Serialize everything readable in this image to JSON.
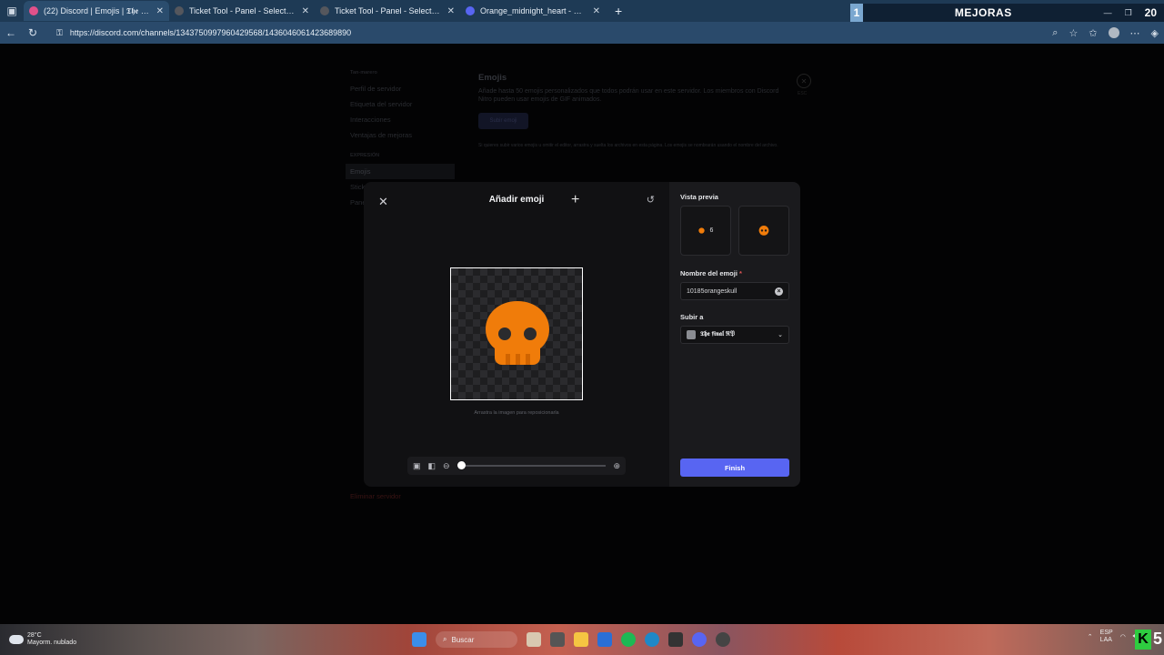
{
  "browser": {
    "tabs": [
      {
        "title": "(22) Discord | Emojis | 𝕿𝖍𝖊 𝖋𝖎𝖓𝖆𝖑 ℜ𝔓",
        "color": "#e0518a",
        "active": true
      },
      {
        "title": "Ticket Tool - Panel - Select Style",
        "color": "#2d2f35",
        "active": false
      },
      {
        "title": "Ticket Tool - Panel - Select Style",
        "color": "#2d2f35",
        "active": false
      },
      {
        "title": "Orange_midnight_heart - Discord",
        "color": "#5865f2",
        "active": false
      }
    ],
    "new_tab": "+",
    "url": "https://discord.com/channels/1343750997960429568/1436046061423689890",
    "overlay": {
      "number": "1",
      "label": "MEJORAS",
      "big_number": "20"
    }
  },
  "settings_sidebar": {
    "header_1": "Tan-marero",
    "items_1": [
      "Perfil de servidor",
      "Etiqueta del servidor",
      "Interacciones",
      "Ventajas de mejoras"
    ],
    "header_2": "EXPRESIÓN",
    "items_2": [
      "Emojis",
      "Stickers",
      "Panel de sonidos"
    ],
    "danger": "Eliminar servidor"
  },
  "settings_main": {
    "title": "Emojis",
    "description": "Añade hasta 50 emojis personalizados que todos podrán usar en este servidor. Los miembros con Discord Nitro pueden usar emojis de GIF animados.",
    "upload_button": "Subir emoji",
    "note": "Si quieres subir varios emojis u omitir el editor, arrastra y suelta los archivos en esta página. Los emojis se nombrarán usando el nombre del archivo.",
    "close_hint": "ESC"
  },
  "modal": {
    "title": "Añadir emoji",
    "hint": "Arrastra la imagen para reposicionarla",
    "zoom": 0
  },
  "panel": {
    "preview_label": "Vista previa",
    "preview_count": "6",
    "name_label": "Nombre del emoji",
    "required_mark": "*",
    "name_value": "10185orangeskull",
    "upload_to_label": "Subir a",
    "server_name": "𝕿𝖍𝖊 𝖋𝖎𝖓𝖆𝖑 ℜ𝔓",
    "finish_label": "Finish",
    "accent": "#5865f2",
    "emoji_color": "#f07c0a"
  },
  "taskbar": {
    "weather_temp": "28°C",
    "weather_desc": "Mayorm. nublado",
    "search_label": "Buscar",
    "lang": "ESP",
    "lang2": "LAA",
    "k_label": "K",
    "five": "5"
  }
}
